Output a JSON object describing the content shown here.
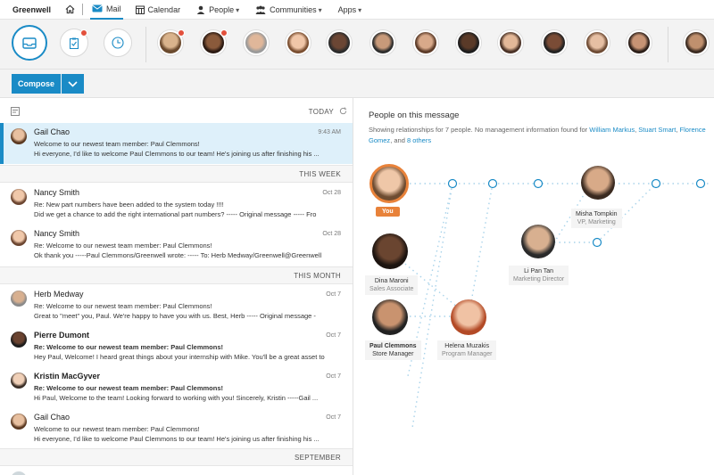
{
  "nav": {
    "brand": "Greenwell",
    "mail": "Mail",
    "calendar": "Calendar",
    "people": "People",
    "communities": "Communities",
    "apps": "Apps"
  },
  "compose": {
    "label": "Compose"
  },
  "list": {
    "today": "TODAY",
    "sections": {
      "this_week": "THIS WEEK",
      "this_month": "THIS MONTH",
      "september": "SEPTEMBER"
    },
    "messages": [
      {
        "sender": "Gail Chao",
        "date": "9:43 AM",
        "subject": "Welcome to our newest team member: Paul Clemmons!",
        "preview": "Hi everyone, I'd like to welcome Paul Clemmons to our team! He's joining us after finishing his ..."
      },
      {
        "sender": "Nancy Smith",
        "date": "Oct 28",
        "subject": "Re: New part numbers have been added to the system today !!!!",
        "preview": "Did we get a chance to add the right international part numbers? ----- Original message ----- Fro"
      },
      {
        "sender": "Nancy Smith",
        "date": "Oct 28",
        "subject": "Re: Welcome to our newest team member: Paul Clemmons!",
        "preview": "Ok thank you -----Paul Clemmons/Greenwell wrote: ----- To: Herb Medway/Greenwell@Greenwell"
      },
      {
        "sender": "Herb Medway",
        "date": "Oct 7",
        "subject": "Re: Welcome to our newest team member: Paul Clemmons!",
        "preview": "Great to \"meet\" you, Paul. We're happy to have you with us. Best, Herb ----- Original message -"
      },
      {
        "sender": "Pierre Dumont",
        "date": "Oct 7",
        "subject": "Re: Welcome to our newest team member: Paul Clemmons!",
        "preview": "Hey Paul, Welcome! I heard great things about your internship with Mike. You'll be a great asset to"
      },
      {
        "sender": "Kristin MacGyver",
        "date": "Oct 7",
        "subject": "Re: Welcome to our newest team member: Paul Clemmons!",
        "preview": "Hi Paul, Welcome to the team! Looking forward to working with you! Sincerely, Kristin -----Gail ..."
      },
      {
        "sender": "Gail Chao",
        "date": "Oct 7",
        "subject": "Welcome to our newest team member: Paul Clemmons!",
        "preview": "Hi everyone, I'd like to welcome Paul Clemmons to our team! He's joining us after finishing his ..."
      }
    ]
  },
  "panel": {
    "title": "People on this message",
    "desc_prefix": "Showing relationships for 7 people.  No management information found for",
    "link1": "William Markus",
    "link2": "Stuart Smart",
    "link3": "Florence Gomez",
    "desc_and": ", and",
    "link4": "8 others",
    "you": "You",
    "people": [
      {
        "name": "Misha Tompkin",
        "role": "VP, Marketing"
      },
      {
        "name": "Li Pan Tan",
        "role": "Marketing Director"
      },
      {
        "name": "Dina Maroni",
        "role": "Sales Associate"
      },
      {
        "name": "Paul Clemmons",
        "role": "Store Manager"
      },
      {
        "name": "Helena Muzakis",
        "role": "Program Manager"
      }
    ]
  },
  "colors": {
    "accent": "#1a8bc6",
    "highlight": "#e8823a",
    "badge": "#e2503c"
  },
  "icons": [
    "home-icon",
    "mail-icon",
    "calendar-icon",
    "people-icon",
    "communities-icon",
    "inbox-icon",
    "clipboard-icon",
    "clock-icon",
    "list-icon",
    "refresh-icon",
    "chevron-down-icon"
  ]
}
